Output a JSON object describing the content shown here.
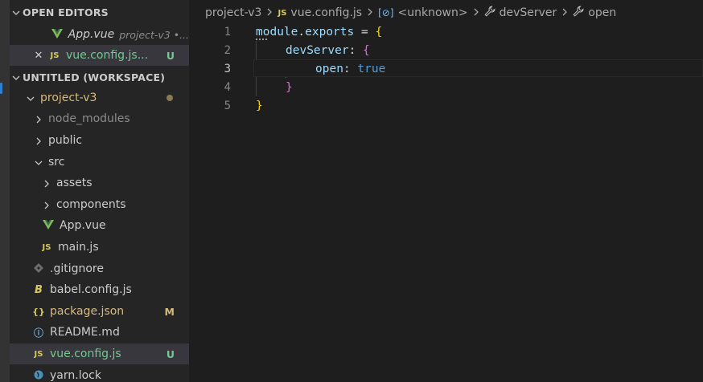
{
  "sidebar": {
    "open_editors_header": "OPEN EDITORS",
    "open_editors": [
      {
        "name": "App.vue",
        "description": "project-v3 •...",
        "icon": "vue-icon"
      },
      {
        "name": "vue.config.js...",
        "badge": "U",
        "icon": "js-icon",
        "close": "✕"
      }
    ],
    "workspace_header": "UNTITLED (WORKSPACE)",
    "project": "project-v3",
    "tree": {
      "node_modules": "node_modules",
      "public": "public",
      "src": "src",
      "assets": "assets",
      "components": "components",
      "app_vue": "App.vue",
      "main_js": "main.js",
      "gitignore": ".gitignore",
      "babel": "babel.config.js",
      "package": "package.json",
      "package_badge": "M",
      "readme": "README.md",
      "vue_config": "vue.config.js",
      "vue_config_badge": "U",
      "yarn": "yarn.lock"
    },
    "icons": {
      "js_label": "JS",
      "json_label": "{}",
      "info_label": "ⓘ",
      "babel_label": "B"
    }
  },
  "breadcrumb": {
    "project": "project-v3",
    "file": "vue.config.js",
    "file_icon": "JS",
    "symbol": "<unknown>",
    "symbol_icon": "[⊘]",
    "prop1": "devServer",
    "prop2": "open"
  },
  "code": {
    "line_numbers": [
      "1",
      "2",
      "3",
      "4",
      "5"
    ],
    "l1": {
      "obj": "module",
      "dot": ".",
      "prop": "exports",
      "op": " = ",
      "brace": "{"
    },
    "l2": {
      "key": "devServer",
      "colon": ": ",
      "brace": "{"
    },
    "l3": {
      "key": "open",
      "colon": ": ",
      "value": "true"
    },
    "l4": {
      "brace": "}"
    },
    "l5": {
      "brace": "}"
    },
    "current_line": 3
  },
  "colors": {
    "accent": "#2f7fd0",
    "untracked": "#73c991",
    "modified": "#d7ba7d"
  }
}
